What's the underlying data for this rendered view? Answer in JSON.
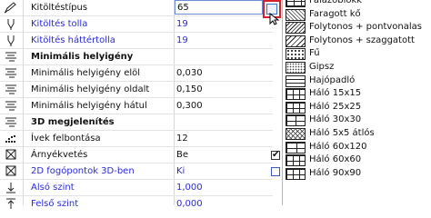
{
  "properties": [
    {
      "icon": "pencil-icon",
      "label": "Kitöltéstípus",
      "value": "65",
      "label_style": "",
      "value_style": ""
    },
    {
      "icon": "pen-tip-icon",
      "label": "Kitöltés tolla",
      "value": "19",
      "label_style": "blue",
      "value_style": "blue"
    },
    {
      "icon": "pen-tip-icon",
      "label": "Kitöltés háttértolla",
      "value": "19",
      "label_style": "blue",
      "value_style": "blue"
    },
    {
      "icon": "list-lines-icon",
      "label": "Minimális helyigény",
      "value": "",
      "label_style": "bold",
      "value_style": ""
    },
    {
      "icon": "list-lines-icon",
      "label": "Minimális helyigény elöl",
      "value": "0,030",
      "label_style": "",
      "value_style": ""
    },
    {
      "icon": "list-lines-icon",
      "label": "Minimális helyigény oldalt",
      "value": "0,150",
      "label_style": "",
      "value_style": ""
    },
    {
      "icon": "list-lines-icon",
      "label": "Minimális helyigény hátul",
      "value": "0,300",
      "label_style": "",
      "value_style": ""
    },
    {
      "icon": "list-lines-icon",
      "label": "3D megjelenítés",
      "value": "",
      "label_style": "bold",
      "value_style": ""
    },
    {
      "icon": "dot-grid-icon",
      "label": "Ívek felbontása",
      "value": "12",
      "label_style": "",
      "value_style": ""
    },
    {
      "icon": "shadow-box-icon",
      "label": "Árnyékvetés",
      "value": "Be",
      "label_style": "",
      "value_style": ""
    },
    {
      "icon": "shadow-box-icon",
      "label": "2D fogópontok 3D-ben",
      "value": "Ki",
      "label_style": "blue",
      "value_style": "blue"
    },
    {
      "icon": "level-arrow-icon",
      "label": "Alsó szint",
      "value": "1,000",
      "label_style": "blue",
      "value_style": "blue"
    },
    {
      "icon": "level-arrow-icon",
      "label": "Felső szint",
      "value": "0,000",
      "label_style": "blue",
      "value_style": "blue"
    }
  ],
  "checkboxes": [
    {
      "row": "Árnyékvetés",
      "checked": true,
      "mark": "✔"
    },
    {
      "row": "2D fogópontok 3D-ben",
      "checked": false,
      "mark": ""
    }
  ],
  "fill_popup": {
    "items": [
      {
        "label": "Falazóblokk",
        "pattern": "brick"
      },
      {
        "label": "Faragott kő",
        "pattern": "stone"
      },
      {
        "label": "Folytonos + pontvonalas",
        "pattern": "diag"
      },
      {
        "label": "Folytonos + szaggatott",
        "pattern": "dash"
      },
      {
        "label": "Fű",
        "pattern": "grass"
      },
      {
        "label": "Gipsz",
        "pattern": "gypsum"
      },
      {
        "label": "Hajópadló",
        "pattern": "hajo"
      },
      {
        "label": "Háló 15x15",
        "pattern": "g15"
      },
      {
        "label": "Háló 25x25",
        "pattern": "g25"
      },
      {
        "label": "Háló 30x30",
        "pattern": "g30"
      },
      {
        "label": "Háló 5x5 átlós",
        "pattern": "g5x5"
      },
      {
        "label": "Háló 60x120",
        "pattern": "g60x120"
      },
      {
        "label": "Háló 60x60",
        "pattern": "g60x60"
      },
      {
        "label": "Háló 90x90",
        "pattern": "g90"
      }
    ]
  },
  "colors": {
    "blue_text": "#2a2adb",
    "highlight_border": "#d8202a",
    "field_border": "#6c8fd1"
  }
}
